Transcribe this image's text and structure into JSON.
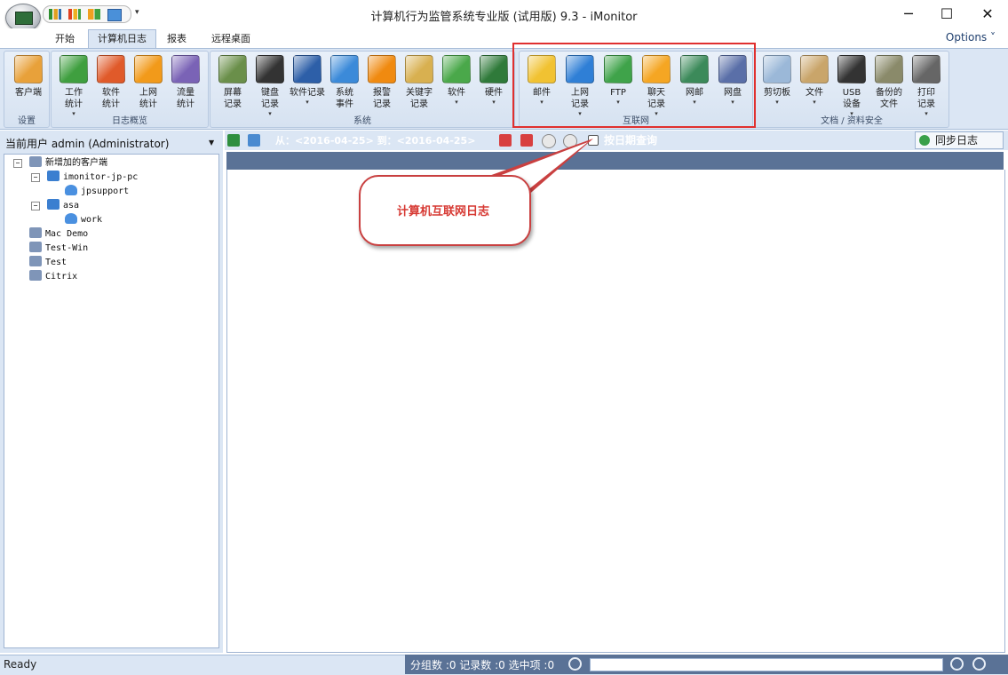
{
  "window": {
    "title": "计算机行为监管系统专业版 (试用版) 9.3 - iMonitor",
    "minimize": "─",
    "maximize": "☐",
    "close": "✕"
  },
  "qat": {
    "dropdown": "▾"
  },
  "tabs": [
    {
      "label": "开始"
    },
    {
      "label": "计算机日志"
    },
    {
      "label": "报表"
    },
    {
      "label": "远程桌面"
    }
  ],
  "options_label": "Options ˅",
  "ribbon": {
    "groups": [
      {
        "label": "设置",
        "buttons": [
          {
            "line1": "客户端",
            "line2": "",
            "dd": false,
            "icon": "client-settings-icon",
            "color": "#e8a13a"
          }
        ]
      },
      {
        "label": "日志概览",
        "buttons": [
          {
            "line1": "工作",
            "line2": "统计",
            "dd": true,
            "icon": "work-stats-icon",
            "color": "#3f9f3f"
          },
          {
            "line1": "软件",
            "line2": "统计",
            "dd": false,
            "icon": "software-stats-icon",
            "color": "#e05a2a"
          },
          {
            "line1": "上网",
            "line2": "统计",
            "dd": false,
            "icon": "web-stats-icon",
            "color": "#f29a1a"
          },
          {
            "line1": "流量",
            "line2": "统计",
            "dd": false,
            "icon": "traffic-stats-icon",
            "color": "#7a63b6"
          }
        ]
      },
      {
        "label": "系统",
        "buttons": [
          {
            "line1": "屏幕",
            "line2": "记录",
            "dd": false,
            "icon": "screen-record-icon",
            "color": "#6a8f4a"
          },
          {
            "line1": "键盘",
            "line2": "记录",
            "dd": true,
            "icon": "keyboard-icon",
            "color": "#333333"
          },
          {
            "line1": "软件记录",
            "line2": "",
            "dd": true,
            "icon": "software-record-icon",
            "color": "#2d5fa8"
          },
          {
            "line1": "系统",
            "line2": "事件",
            "dd": false,
            "icon": "windows-event-icon",
            "color": "#3b8ad9"
          },
          {
            "line1": "报警",
            "line2": "记录",
            "dd": false,
            "icon": "alert-icon",
            "color": "#f08a10"
          },
          {
            "line1": "关键字",
            "line2": "记录",
            "dd": false,
            "icon": "keyword-icon",
            "color": "#d8b050"
          },
          {
            "line1": "软件",
            "line2": "",
            "dd": true,
            "icon": "software-install-icon",
            "color": "#4aa84a"
          },
          {
            "line1": "硬件",
            "line2": "",
            "dd": true,
            "icon": "hardware-icon",
            "color": "#2f7a3a"
          }
        ]
      },
      {
        "label": "互联网",
        "buttons": [
          {
            "line1": "邮件",
            "line2": "",
            "dd": true,
            "icon": "mail-icon",
            "color": "#f1c232"
          },
          {
            "line1": "上网",
            "line2": "记录",
            "dd": true,
            "icon": "web-record-icon",
            "color": "#2f7fd6"
          },
          {
            "line1": "FTP",
            "line2": "",
            "dd": true,
            "icon": "ftp-icon",
            "color": "#3fa34a"
          },
          {
            "line1": "聊天",
            "line2": "记录",
            "dd": true,
            "icon": "chat-icon",
            "color": "#f5a623"
          },
          {
            "line1": "网邮",
            "line2": "",
            "dd": true,
            "icon": "webmail-icon",
            "color": "#3c8a5a"
          },
          {
            "line1": "网盘",
            "line2": "",
            "dd": true,
            "icon": "cloud-disk-icon",
            "color": "#5a6fa8"
          }
        ]
      },
      {
        "label": "文档 / 资料安全",
        "buttons": [
          {
            "line1": "剪切板",
            "line2": "",
            "dd": true,
            "icon": "clipboard-star-icon",
            "color": "#9bb8d8"
          },
          {
            "line1": "文件",
            "line2": "",
            "dd": true,
            "icon": "file-icon",
            "color": "#c9a56a"
          },
          {
            "line1": "USB",
            "line2": "设备",
            "dd": true,
            "icon": "usb-icon",
            "color": "#333333"
          },
          {
            "line1": "备份的",
            "line2": "文件",
            "dd": false,
            "icon": "backup-icon",
            "color": "#8a8a6a"
          },
          {
            "line1": "打印",
            "line2": "记录",
            "dd": true,
            "icon": "printer-icon",
            "color": "#666666"
          }
        ]
      }
    ]
  },
  "left": {
    "user_label": "当前用户 admin (Administrator)",
    "dd": "▼",
    "tree": [
      {
        "label": "新增加的客户端",
        "level": 0,
        "icon": "group-icon",
        "expander": "−"
      },
      {
        "label": "imonitor-jp-pc",
        "level": 1,
        "icon": "computer-icon",
        "expander": "−"
      },
      {
        "label": "jpsupport",
        "level": 2,
        "icon": "user-icon",
        "expander": ""
      },
      {
        "label": "asa",
        "level": 1,
        "icon": "computer-icon",
        "expander": "−"
      },
      {
        "label": "work",
        "level": 2,
        "icon": "user-icon",
        "expander": ""
      },
      {
        "label": "Mac Demo",
        "level": 0,
        "icon": "group-icon",
        "expander": ""
      },
      {
        "label": "Test-Win",
        "level": 0,
        "icon": "group-icon",
        "expander": ""
      },
      {
        "label": "Test",
        "level": 0,
        "icon": "group-icon",
        "expander": ""
      },
      {
        "label": "Citrix",
        "level": 0,
        "icon": "group-icon",
        "expander": ""
      }
    ]
  },
  "content": {
    "date_range": "从：<2016-04-25> 到：<2016-04-25>",
    "date_query": "按日期查询",
    "sync_label": "同步日志"
  },
  "callout": {
    "text": "计算机互联网日志"
  },
  "status": {
    "ready": "Ready",
    "counts": "分组数 :0  记录数 :0  选中项 :0"
  },
  "colors": {
    "ribbon_bg": "#dbe6f4",
    "header_dark": "#5a7296",
    "highlight": "#e0302f",
    "callout_text": "#d73a34"
  }
}
